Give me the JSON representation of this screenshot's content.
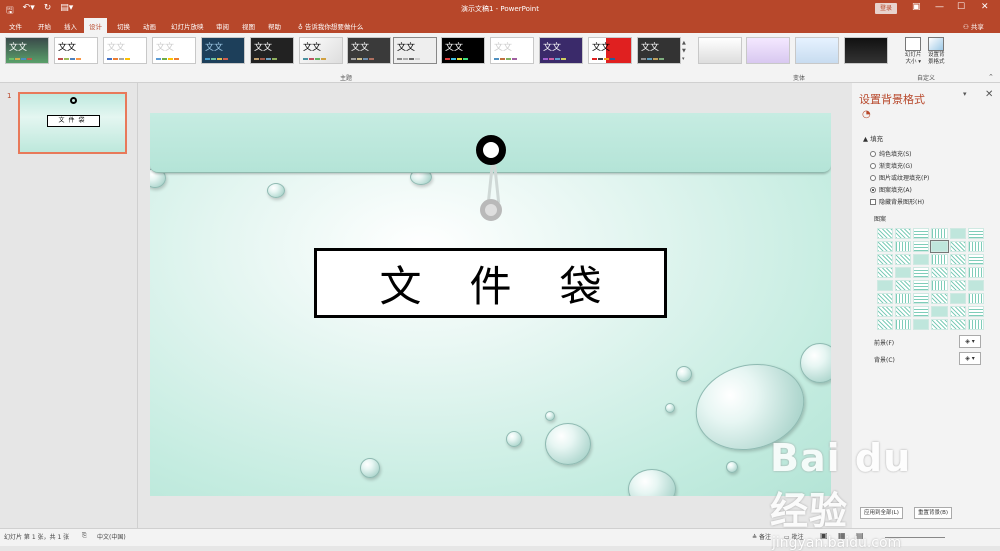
{
  "window": {
    "title": "演示文稿1 - PowerPoint",
    "login_label": "登录",
    "share_label": "共享"
  },
  "tabs": [
    "文件",
    "开始",
    "插入",
    "设计",
    "切换",
    "动画",
    "幻灯片放映",
    "审阅",
    "视图",
    "帮助"
  ],
  "active_tab": "设计",
  "tell_me": "告诉我你想要做什么",
  "ribbon": {
    "themes_label": "主题",
    "variants_label": "变体",
    "customize_label": "自定义",
    "theme_text": "文文",
    "slide_size_label": "幻灯片\n大小 ▾",
    "format_bg_label": "设置背\n景格式"
  },
  "thumbnail": {
    "number": "1",
    "text": "文件袋"
  },
  "slide": {
    "title": "文件袋"
  },
  "format_pane": {
    "title": "设置背景格式",
    "fill_header": "▲ 填充",
    "options": [
      "纯色填充(S)",
      "渐变填充(G)",
      "图片或纹理填充(P)",
      "图案填充(A)"
    ],
    "selected_option": "图案填充(A)",
    "hide_bg": "隐藏背景图形(H)",
    "pattern_label": "图案",
    "foreground_label": "前景(F)",
    "background_label": "背景(C)",
    "apply_all": "应用到全部(L)",
    "reset": "重置背景(B)"
  },
  "status": {
    "slide_info": "幻灯片 第 1 张，共 1 张",
    "language": "中文(中国)",
    "notes": "备注",
    "comments": "批注"
  },
  "watermark": {
    "logo": "Bai du 经验",
    "url": "jingyan.baidu.com"
  }
}
